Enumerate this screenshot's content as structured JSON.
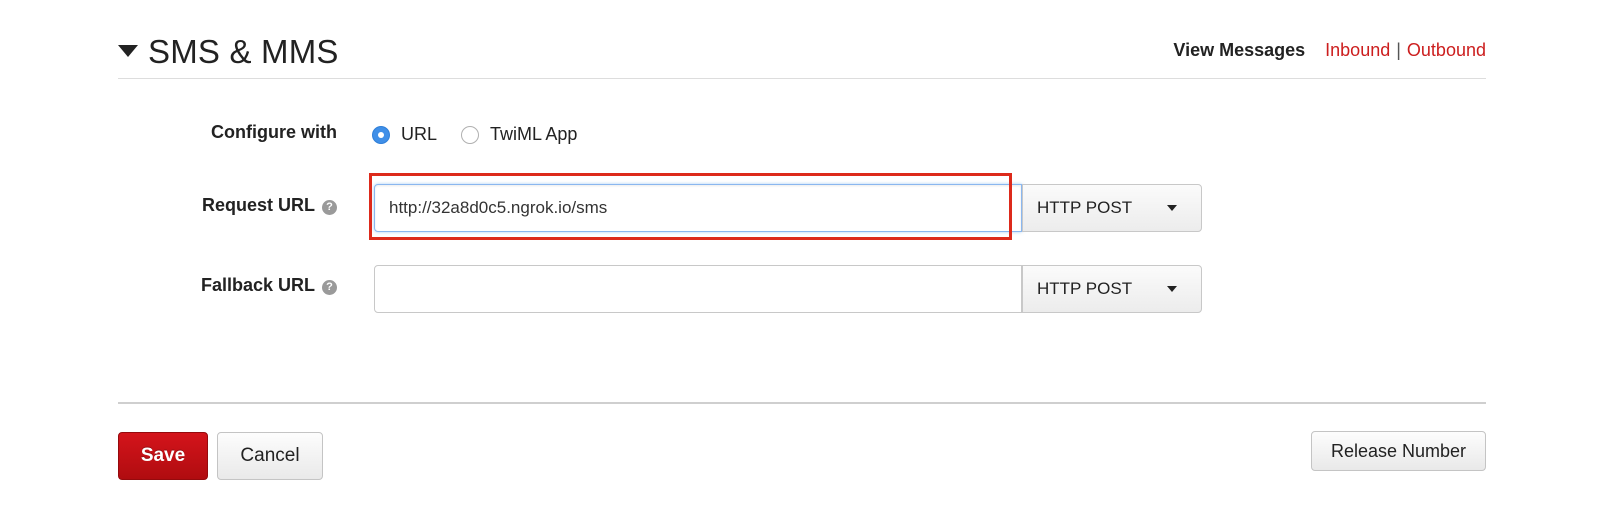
{
  "section": {
    "title": "SMS & MMS",
    "view_messages_label": "View Messages",
    "inbound_link": "Inbound",
    "separator": "|",
    "outbound_link": "Outbound"
  },
  "configure": {
    "label": "Configure with",
    "options": [
      {
        "label": "URL",
        "selected": true
      },
      {
        "label": "TwiML App",
        "selected": false
      }
    ]
  },
  "request_url": {
    "label": "Request URL",
    "help_icon": "?",
    "value": "http://32a8d0c5.ngrok.io/sms",
    "placeholder": "",
    "method": "HTTP POST"
  },
  "fallback_url": {
    "label": "Fallback URL",
    "help_icon": "?",
    "value": "",
    "placeholder": "",
    "method": "HTTP POST"
  },
  "buttons": {
    "save": "Save",
    "cancel": "Cancel",
    "release": "Release Number"
  },
  "colors": {
    "accent_red": "#cc1e1e",
    "save_button": "#c41016",
    "radio_selected": "#3f8fe8",
    "highlight_box": "#dd2a1b"
  },
  "icons": {
    "section_toggle": "caret-down-icon",
    "help": "question-circle-icon",
    "dropdown": "caret-down-icon"
  }
}
